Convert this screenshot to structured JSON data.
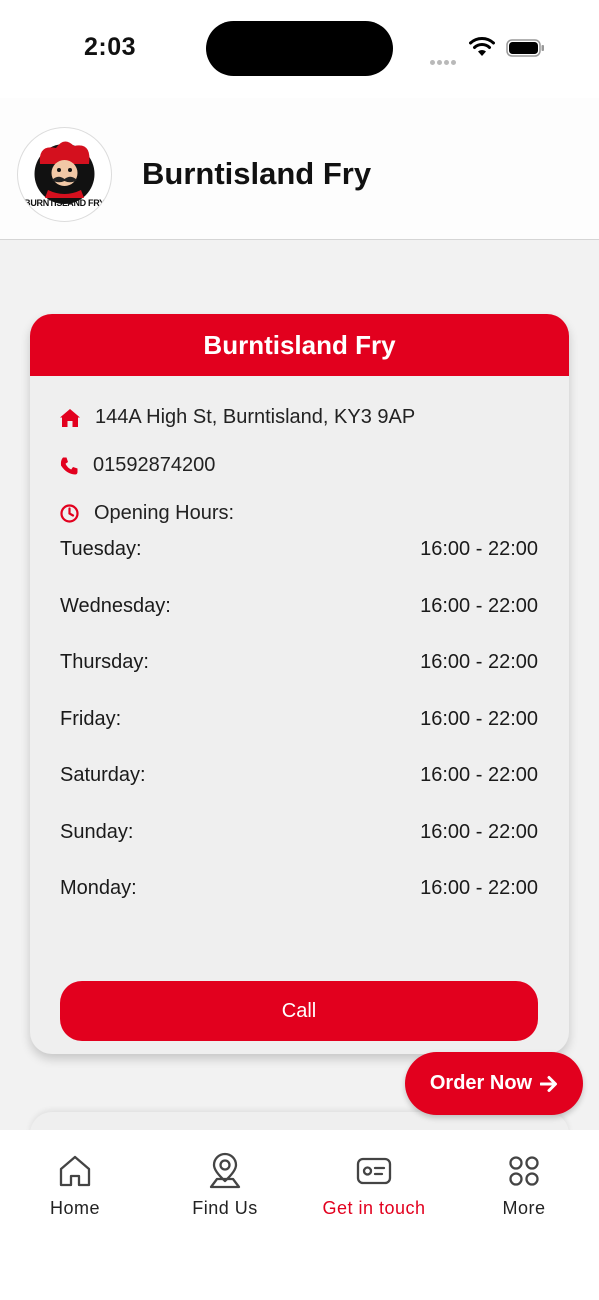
{
  "status_bar": {
    "time": "2:03"
  },
  "header": {
    "title": "Burntisland Fry",
    "logo_text": "BURNTISLAND FRY"
  },
  "card": {
    "title": "Burntisland Fry",
    "address": "144A High St, Burntisland, KY3 9AP",
    "phone": "01592874200",
    "hours_label": "Opening Hours:",
    "hours": [
      {
        "day": "Tuesday:",
        "time": "16:00 - 22:00"
      },
      {
        "day": "Wednesday:",
        "time": "16:00 - 22:00"
      },
      {
        "day": "Thursday:",
        "time": "16:00 - 22:00"
      },
      {
        "day": "Friday:",
        "time": "16:00 - 22:00"
      },
      {
        "day": "Saturday:",
        "time": "16:00 - 22:00"
      },
      {
        "day": "Sunday:",
        "time": "16:00 - 22:00"
      },
      {
        "day": "Monday:",
        "time": "16:00 - 22:00"
      }
    ],
    "call_label": "Call"
  },
  "order_button": {
    "label": "Order Now"
  },
  "tabs": [
    {
      "label": "Home",
      "icon": "home-icon"
    },
    {
      "label": "Find Us",
      "icon": "location-pin-icon"
    },
    {
      "label": "Get in touch",
      "icon": "contact-card-icon",
      "active": true
    },
    {
      "label": "More",
      "icon": "grid-icon"
    }
  ],
  "colors": {
    "accent": "#e2001e",
    "background": "#f2f2f2",
    "card": "#efefef"
  }
}
